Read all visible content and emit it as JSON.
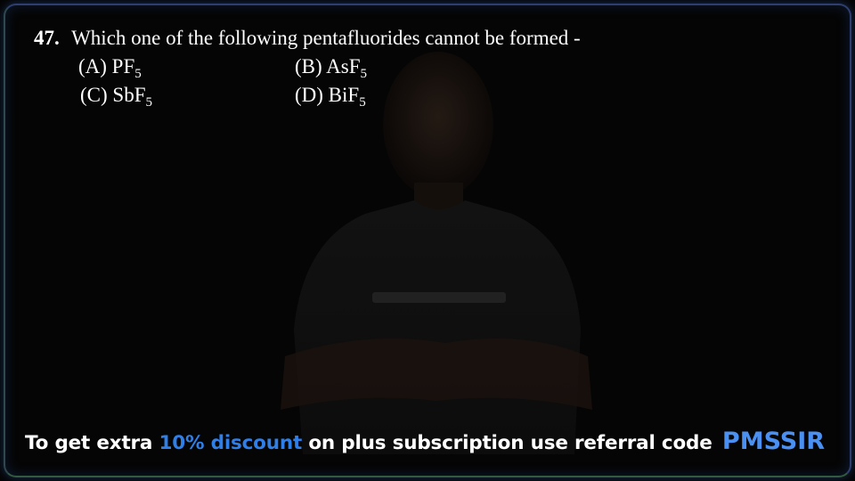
{
  "question": {
    "number": "47.",
    "text": "Which one of the following pentafluorides cannot be formed -",
    "options": [
      {
        "label": "(A) PF",
        "subscript": "5"
      },
      {
        "label": "(B) AsF",
        "subscript": "5"
      },
      {
        "label": "(C) SbF",
        "subscript": "5"
      },
      {
        "label": "(D) BiF",
        "subscript": "5"
      }
    ]
  },
  "promo": {
    "part1": "To get extra ",
    "highlight": "10% discount",
    "part2": " on plus subscription use referral code",
    "code": "PMSSIR"
  },
  "colors": {
    "background": "#050505",
    "text": "#ffffff",
    "accent": "#2f7fe8"
  }
}
